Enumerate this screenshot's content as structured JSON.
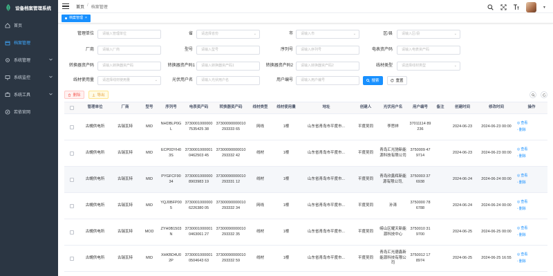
{
  "app": {
    "title": "设备档案管理系统"
  },
  "sidebar": {
    "items": [
      {
        "label": "首页",
        "icon": "home-icon"
      },
      {
        "label": "档案管理",
        "icon": "archive-icon",
        "active": true
      },
      {
        "label": "系统管理",
        "icon": "gear-icon",
        "expandable": true
      },
      {
        "label": "系统监控",
        "icon": "monitor-icon",
        "expandable": true
      },
      {
        "label": "系统工具",
        "icon": "tool-icon",
        "expandable": true
      },
      {
        "label": "若依官网",
        "icon": "compass-icon"
      }
    ]
  },
  "header": {
    "breadcrumb": [
      "首页",
      "档案管理"
    ],
    "tools": [
      "search-icon",
      "fullscreen-icon",
      "font-size-icon"
    ]
  },
  "tags": [
    {
      "label": "档案管理"
    }
  ],
  "search": {
    "row1": [
      {
        "label": "管理单位",
        "placeholder": "请输入管理单位"
      },
      {
        "label": "省",
        "placeholder": "请选择省份"
      },
      {
        "label": "市",
        "placeholder": "请输入市"
      },
      {
        "label": "区/县",
        "placeholder": "请输入区/县"
      }
    ],
    "row2": [
      {
        "label": "厂商",
        "placeholder": "请输入厂商"
      },
      {
        "label": "型号",
        "placeholder": "请输入型号"
      },
      {
        "label": "序列号",
        "placeholder": "请输入序列号"
      },
      {
        "label": "电表资产码",
        "placeholder": "请输入电表资产码"
      }
    ],
    "row3": [
      {
        "label": "转换器资产码",
        "placeholder": "请输入转换器资产码"
      },
      {
        "label": "转换器资产码1",
        "placeholder": "请输入转换器资产码1"
      },
      {
        "label": "转换器资产码2",
        "placeholder": "请输入转换器资产码2"
      },
      {
        "label": "线材类型",
        "placeholder": "请选择线材类型"
      }
    ],
    "row4": [
      {
        "label": "线材使用量",
        "placeholder": "请选择线材使用量"
      },
      {
        "label": "光伏用户名",
        "placeholder": "请输入光伏用户名"
      },
      {
        "label": "用户编号",
        "placeholder": "请输入用户编号"
      }
    ],
    "search_label": "搜索",
    "reset_label": "重置"
  },
  "actions": {
    "delete_label": "删除",
    "export_label": "导出"
  },
  "table": {
    "columns": [
      "管理单位",
      "厂商",
      "型号",
      "序列号",
      "电表资产码",
      "转换器资产码",
      "线材类型",
      "线材使用量",
      "地址",
      "创建人",
      "光伏用户名",
      "用户编号",
      "备注",
      "创建时间",
      "修改时间",
      "操作"
    ],
    "view_label": "查看",
    "delete_label": "删除",
    "rows": [
      {
        "unit": "古蜆供电所",
        "vendor": "古瑞瓦特",
        "model": "MID",
        "serial": "NHDBLP0GL",
        "meter": "37300010000007535425 38",
        "conv": "37300090000010293333 65",
        "wire": "网线",
        "qty": "1根",
        "addr": "山东省青岛市平度市...",
        "creator": "平度吴同",
        "pv_user": "李思祥",
        "user_no": "37011114 89236",
        "note": "",
        "created": "2024-06-23",
        "updated": "2024-06-23 00:00"
      },
      {
        "unit": "古蜆供电所",
        "vendor": "古瑞瓦特",
        "model": "MID",
        "serial": "ECP0DYH03S",
        "meter": "37300010000010462503 45",
        "conv": "37300090000010293332 42",
        "wire": "线材",
        "qty": "1根",
        "addr": "山东省青岛市平度市...",
        "creator": "平度吴同",
        "pv_user": "青岛汇光驰新能源科技有限公司",
        "user_no": "3750009 479714",
        "note": "",
        "created": "2024-06-23",
        "updated": "2024-06-23 00:00"
      },
      {
        "unit": "古蜆供电所",
        "vendor": "古瑞瓦特",
        "model": "MID",
        "serial": "PYGFCF9034",
        "meter": "37300010000008903983 19",
        "conv": "37300090000010293331 12",
        "wire": "线材",
        "qty": "1根",
        "addr": "山东省青岛市平度市...",
        "creator": "平度吴同",
        "pv_user": "青岛欣鑫辉新能源有限公司,",
        "user_no": "3750003 376938",
        "note": "",
        "created": "2024-06-24",
        "updated": "2024-06-24 00:00"
      },
      {
        "unit": "古蜆供电所",
        "vendor": "古瑞瓦特",
        "model": "MID",
        "serial": "YQJ0BFP005",
        "meter": "37300010000006226380 05",
        "conv": "37300090000010293332 34",
        "wire": "网线",
        "qty": "1根",
        "addr": "山东省青岛市平度市...",
        "creator": "平度吴同",
        "pv_user": "孙涛",
        "user_no": "3750000 786788",
        "note": "",
        "created": "2024-06-24",
        "updated": "2024-06-24 00:00"
      },
      {
        "unit": "古蜆供电所",
        "vendor": "古瑞瓦特",
        "model": "MOD",
        "serial": "ZYH0B1503N",
        "meter": "37300010000010463061 27",
        "conv": "37300090000010293332 35",
        "wire": "线材",
        "qty": "1根",
        "addr": "山东省青岛市平度市...",
        "creator": "平度吴同",
        "pv_user": "崂山区耀天新能源科技中心",
        "user_no": "3750010 319700",
        "note": "",
        "created": "2024-06-25",
        "updated": "2024-06-25 00:00"
      },
      {
        "unit": "古蜆供电所",
        "vendor": "古瑞瓦特",
        "model": "MID",
        "serial": "XHKBD4U02P",
        "meter": "37300010000010504643 63",
        "conv": "37300090000010293332 59",
        "wire": "线材",
        "qty": "1根",
        "addr": "山东省青岛市平度市...",
        "creator": "平度吴同",
        "pv_user": "青岛汇光德鑫新能源科技有限公司",
        "user_no": "3750012 178974",
        "note": "",
        "created": "2024-06-25",
        "updated": "2024-06-25 16:55"
      }
    ]
  },
  "colors": {
    "sidebar_bg": "#2b3643",
    "accent": "#1890ff",
    "danger": "#f5605a",
    "warning": "#e6a23c"
  }
}
